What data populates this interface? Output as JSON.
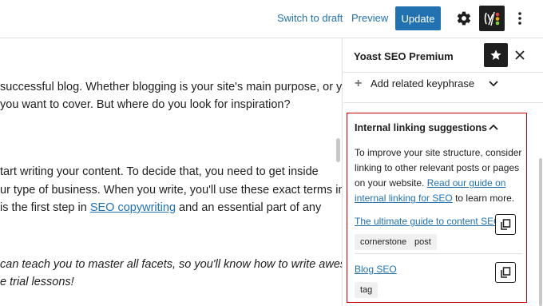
{
  "toolbar": {
    "switch_to_draft": "Switch to draft",
    "preview": "Preview",
    "update": "Update",
    "settings_icon": "gear-icon",
    "yoast_icon": "yoast-logo-icon",
    "more_icon": "kebab-menu-icon",
    "accent_color": "#2271b1"
  },
  "editor": {
    "lines": [
      {
        "pre": "successful blog. Whether blogging is your site's main purpose, or you",
        "link": "",
        "post": ""
      },
      {
        "pre": " you want to cover. But where do you look for inspiration?",
        "link": "",
        "post": ""
      },
      {
        "pre": "tart writing your content. To decide that, you need to get inside",
        "link": "",
        "post": ""
      },
      {
        "pre": "ur type of business. When you write, you'll use these exact terms in",
        "link": "",
        "post": ""
      },
      {
        "pre": " is the first step in ",
        "link": "SEO copywriting",
        "post": " and an essential part of any"
      },
      {
        "pre": " can teach you to master all facets, so you'll know how to write awesome",
        "link": "",
        "post": ""
      },
      {
        "pre": "e trial lessons!",
        "link": "",
        "post": ""
      }
    ]
  },
  "sidebar": {
    "title": "Yoast SEO Premium",
    "star_icon": "star-icon",
    "close_icon": "close-icon",
    "add_keyphrase": "Add related keyphrase",
    "internal_linking": {
      "title": "Internal linking suggestions",
      "desc_pre": "To improve your site structure, consider linking to other relevant posts or pages on your website. ",
      "desc_link": "Read our guide on internal linking for SEO",
      "desc_post": " to learn more.",
      "suggestions": [
        {
          "title": "The ultimate guide to content SEO",
          "tags": [
            "cornerstone",
            "post"
          ]
        },
        {
          "title": "Blog SEO",
          "tags": [
            "tag"
          ]
        }
      ]
    },
    "highlight_color": "#cc0000"
  }
}
